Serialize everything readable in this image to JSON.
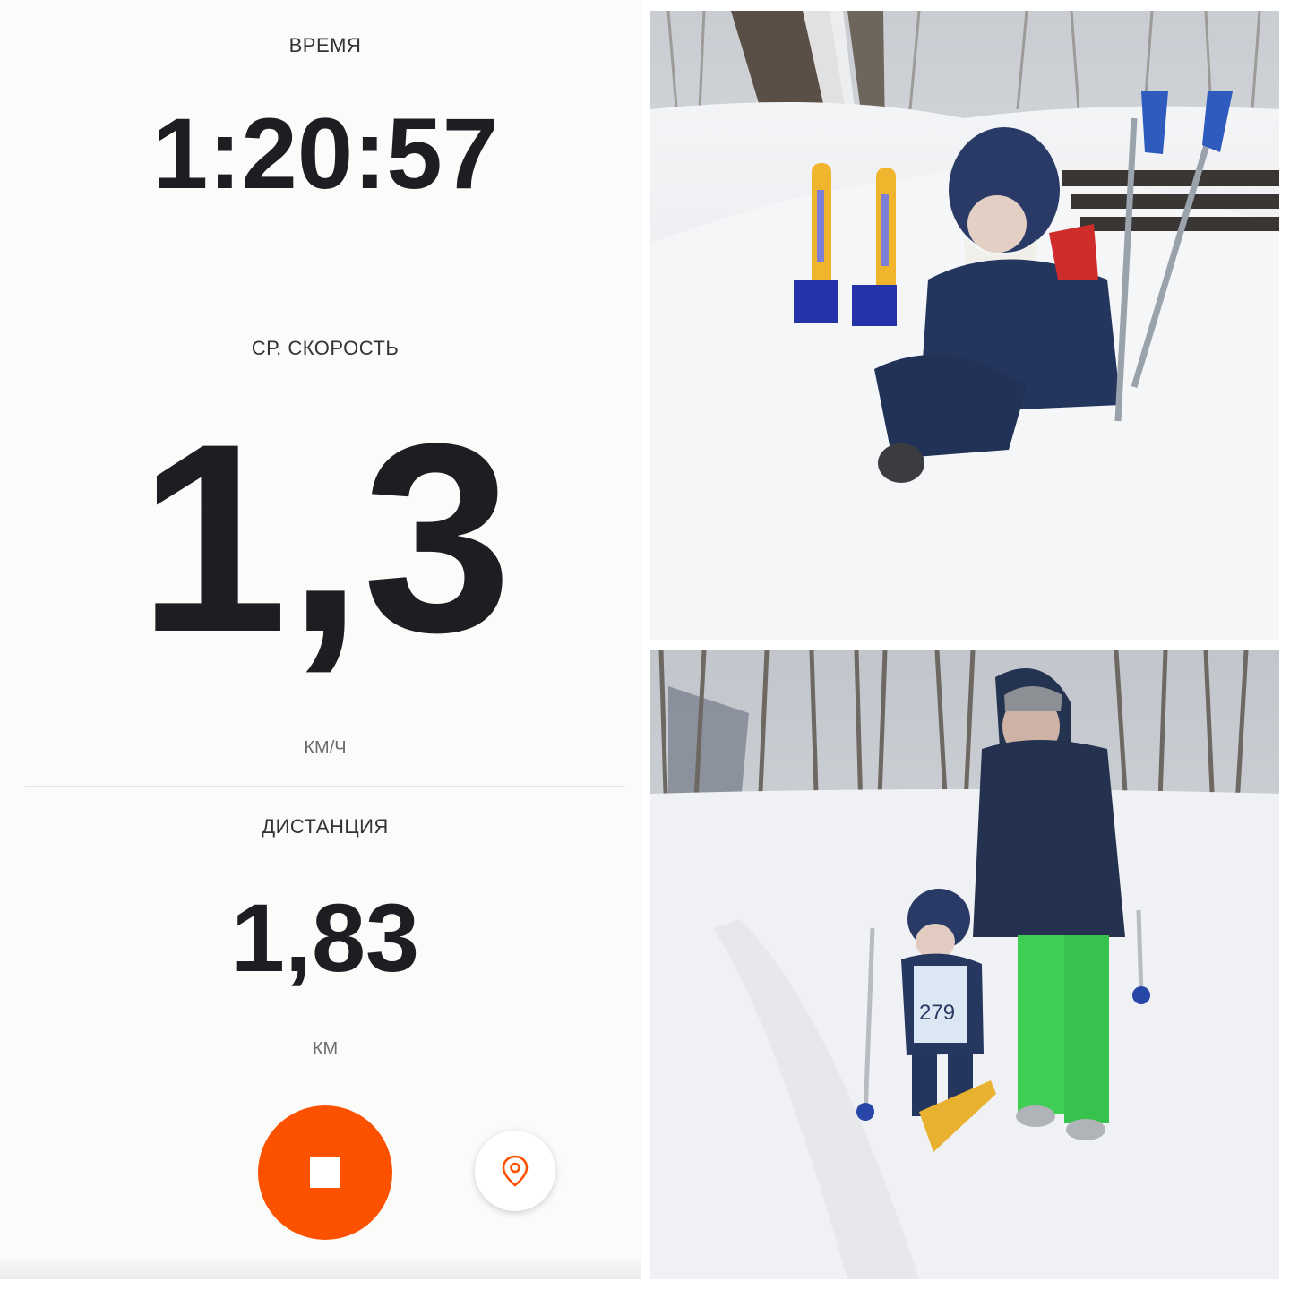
{
  "stats": {
    "time_label": "ВРЕМЯ",
    "time_value": "1:20:57",
    "speed_label": "СР. СКОРОСТЬ",
    "speed_value": "1,3",
    "speed_unit": "КМ/Ч",
    "distance_label": "ДИСТАНЦИЯ",
    "distance_value": "1,83",
    "distance_unit": "КМ"
  },
  "controls": {
    "stop_button": "stop-icon",
    "location_button": "location-pin-icon"
  },
  "photos": {
    "top_bib_text": "",
    "bottom_bib_number": "279"
  },
  "colors": {
    "accent": "#fc5200",
    "text_dark": "#1d1d22"
  }
}
